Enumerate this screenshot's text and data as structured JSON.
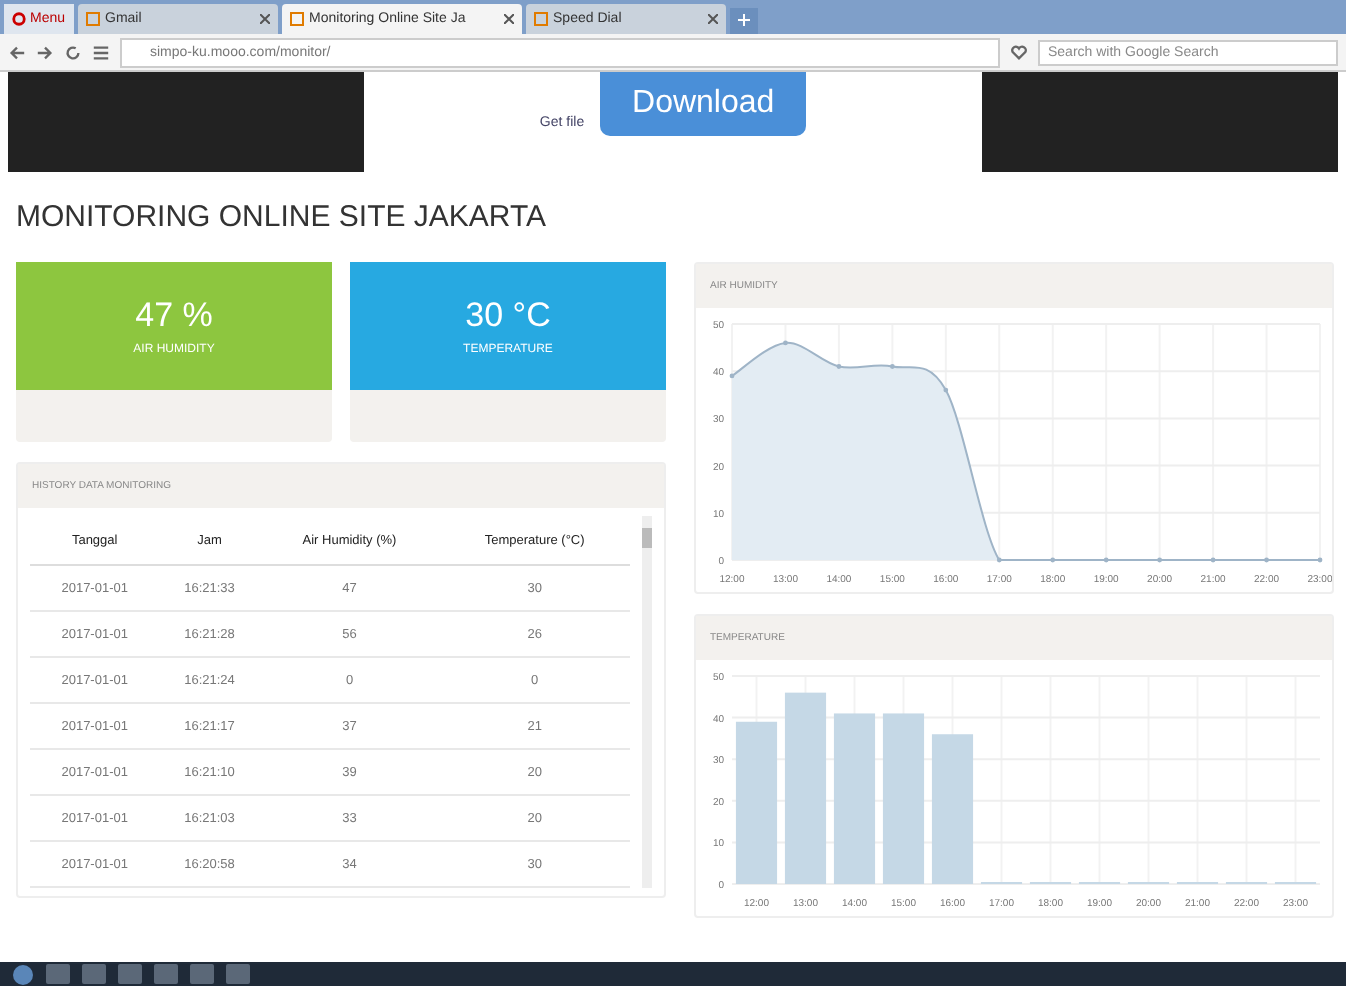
{
  "browser": {
    "menu_label": "Menu",
    "tabs": [
      {
        "title": "Gmail",
        "selected": false
      },
      {
        "title": "Monitoring Online Site Ja",
        "selected": true
      },
      {
        "title": "Speed Dial",
        "selected": false
      }
    ],
    "address": "simpo-ku.mooo.com/monitor/",
    "search": {
      "placeholder": "Search with Google Search"
    }
  },
  "ad": {
    "link": "Get file",
    "button": "Download"
  },
  "page_title": "MONITORING ONLINE SITE JAKARTA",
  "stats": [
    {
      "value": "47 %",
      "label": "AIR HUMIDITY",
      "color": "#8dc63f"
    },
    {
      "value": "30 °C",
      "label": "TEMPERATURE",
      "color": "#27a9e1"
    }
  ],
  "history": {
    "title": "HISTORY DATA MONITORING",
    "columns": [
      "Tanggal",
      "Jam",
      "Air Humidity (%)",
      "Temperature (°C)"
    ],
    "rows": [
      [
        "2017-01-01",
        "16:21:33",
        "47",
        "30"
      ],
      [
        "2017-01-01",
        "16:21:28",
        "56",
        "26"
      ],
      [
        "2017-01-01",
        "16:21:24",
        "0",
        "0"
      ],
      [
        "2017-01-01",
        "16:21:17",
        "37",
        "21"
      ],
      [
        "2017-01-01",
        "16:21:10",
        "39",
        "20"
      ],
      [
        "2017-01-01",
        "16:21:03",
        "33",
        "20"
      ],
      [
        "2017-01-01",
        "16:20:58",
        "34",
        "30"
      ]
    ]
  },
  "humidity_chart": {
    "title": "AIR HUMIDITY",
    "chart_data": {
      "type": "area",
      "categories": [
        "12:00",
        "13:00",
        "14:00",
        "15:00",
        "16:00",
        "17:00",
        "18:00",
        "19:00",
        "20:00",
        "21:00",
        "22:00",
        "23:00"
      ],
      "series": [
        {
          "color": "#9fb4c7",
          "values": [
            39,
            46,
            41,
            41,
            36,
            0,
            0,
            0,
            0,
            0,
            0,
            0
          ]
        }
      ],
      "ylim": [
        0,
        50
      ],
      "yticks": [
        0,
        10,
        20,
        30,
        40,
        50
      ],
      "grid": true
    }
  },
  "temperature_chart": {
    "title": "TEMPERATURE",
    "chart_data": {
      "type": "bar",
      "categories": [
        "12:00",
        "13:00",
        "14:00",
        "15:00",
        "16:00",
        "17:00",
        "18:00",
        "19:00",
        "20:00",
        "21:00",
        "22:00",
        "23:00"
      ],
      "series": [
        {
          "color": "#c5d8e6",
          "values": [
            39,
            46,
            41,
            41,
            36,
            0,
            0,
            0,
            0,
            0,
            0,
            0
          ]
        }
      ],
      "ylim": [
        0,
        50
      ],
      "yticks": [
        0,
        10,
        20,
        30,
        40,
        50
      ],
      "grid": true
    }
  }
}
